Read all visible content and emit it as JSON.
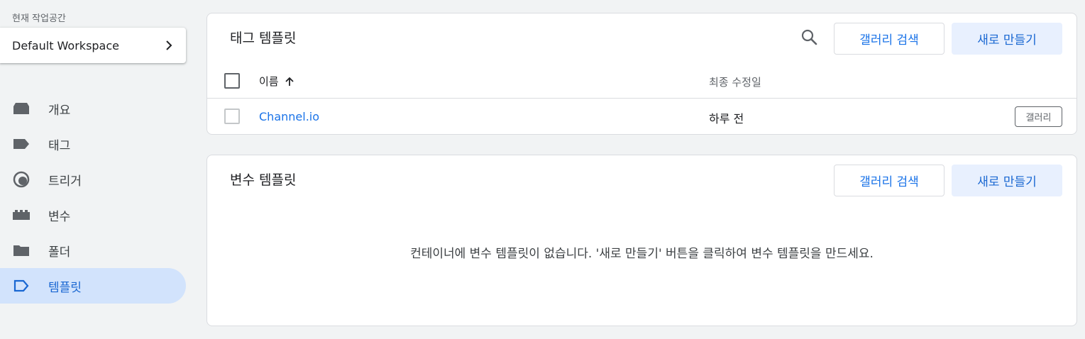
{
  "workspace": {
    "label": "현재 작업공간",
    "name": "Default Workspace"
  },
  "nav": {
    "items": [
      {
        "label": "개요",
        "icon": "overview-icon"
      },
      {
        "label": "태그",
        "icon": "tag-icon"
      },
      {
        "label": "트리거",
        "icon": "trigger-icon"
      },
      {
        "label": "변수",
        "icon": "variable-icon"
      },
      {
        "label": "폴더",
        "icon": "folder-icon"
      },
      {
        "label": "템플릿",
        "icon": "template-icon",
        "active": true
      }
    ]
  },
  "tag_templates": {
    "title": "태그 템플릿",
    "gallery_search_label": "갤러리 검색",
    "new_label": "새로 만들기",
    "columns": {
      "name": "이름",
      "modified": "최종 수정일"
    },
    "rows": [
      {
        "name": "Channel.io",
        "modified": "하루 전",
        "badge": "갤러리"
      }
    ]
  },
  "variable_templates": {
    "title": "변수 템플릿",
    "gallery_search_label": "갤러리 검색",
    "new_label": "새로 만들기",
    "empty_message": "컨테이너에 변수 템플릿이 없습니다. '새로 만들기' 버튼을 클릭하여 변수 템플릿을 만드세요."
  },
  "colors": {
    "accent": "#1a73e8",
    "active_nav_bg": "#d2e3fc",
    "tonal_button_bg": "#e8f0fe",
    "page_bg": "#f1f3f4"
  }
}
